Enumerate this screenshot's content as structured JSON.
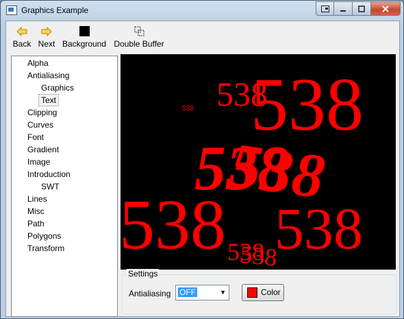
{
  "window": {
    "title": "Graphics Example"
  },
  "toolbar": {
    "back": "Back",
    "next": "Next",
    "background": "Background",
    "double_buffer": "Double Buffer"
  },
  "tree": {
    "alpha": "Alpha",
    "antialiasing": "Antialiasing",
    "graphics": "Graphics",
    "text": "Text",
    "clipping": "Clipping",
    "curves": "Curves",
    "font": "Font",
    "gradient": "Gradient",
    "image": "Image",
    "introduction": "Introduction",
    "swt": "SWT",
    "lines": "Lines",
    "misc": "Misc",
    "path": "Path",
    "polygons": "Polygons",
    "transform": "Transform"
  },
  "canvas": {
    "text": "538",
    "text_color": "#ff0000",
    "background_color": "#000000"
  },
  "settings": {
    "legend": "Settings",
    "antialiasing_label": "Antialiasing",
    "antialiasing_value": "OFF",
    "color_label": "Color",
    "color_value": "#ff0000"
  }
}
